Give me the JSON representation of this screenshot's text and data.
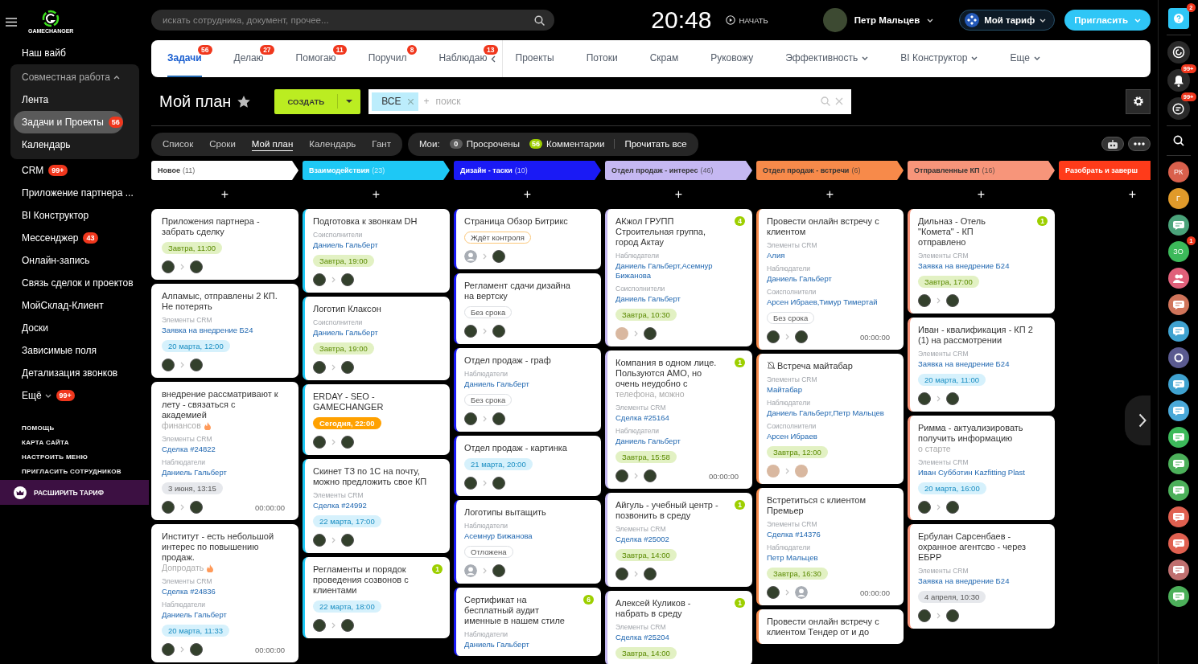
{
  "brand": {
    "name": "GAMECHANGER"
  },
  "sidebar": {
    "items": [
      {
        "label": "Наш вайб"
      },
      {
        "label": "Совместная работа",
        "kind": "group",
        "expanded": true,
        "children": [
          {
            "label": "Лента",
            "selected": false
          },
          {
            "label": "Задачи и Проекты",
            "selected": true,
            "badge": "56"
          },
          {
            "label": "Календарь",
            "selected": false
          }
        ]
      },
      {
        "label": "CRM",
        "badge": "99+"
      },
      {
        "label": "Приложение партнера ..."
      },
      {
        "label": "BI Конструктор"
      },
      {
        "label": "Мессенджер",
        "badge": "43"
      },
      {
        "label": "Онлайн-запись"
      },
      {
        "label": "Связь сделок и проектов"
      },
      {
        "label": "МойСклад-Клиент"
      },
      {
        "label": "Доски"
      },
      {
        "label": "Зависимые поля"
      },
      {
        "label": "Детализация звонков"
      },
      {
        "label": "Ещё",
        "badge": "99+",
        "kind": "more"
      }
    ],
    "links": [
      "ПОМОЩЬ",
      "КАРТА САЙТА",
      "НАСТРОИТЬ МЕНЮ",
      "ПРИГЛАСИТЬ СОТРУДНИКОВ"
    ],
    "upgrade": "РАСШИРИТЬ ТАРИФ"
  },
  "header": {
    "search": {
      "placeholder": "искать сотрудника, документ, прочее..."
    },
    "clock": "20:48",
    "start": "НАЧАТЬ",
    "user": "Петр Мальцев",
    "plan": "Мой тариф",
    "invite": "Пригласить"
  },
  "tabs": [
    {
      "label": "Задачи",
      "count": "56",
      "selected": true,
      "kind": "counter"
    },
    {
      "label": "Делаю",
      "count": "27",
      "selected": false,
      "kind": "counter"
    },
    {
      "label": "Помогаю",
      "count": "11",
      "selected": false,
      "kind": "counter"
    },
    {
      "label": "Поручил",
      "count": "8",
      "selected": false,
      "kind": "counter"
    },
    {
      "label": "Наблюдаю",
      "count": "13",
      "selected": false,
      "kind": "counter"
    },
    {
      "label": "Проекты",
      "selected": false,
      "kind": "plain"
    },
    {
      "label": "Потоки",
      "selected": false,
      "kind": "plain"
    },
    {
      "label": "Скрам",
      "selected": false,
      "kind": "plain"
    },
    {
      "label": "Руковожу",
      "selected": false,
      "kind": "plain"
    },
    {
      "label": "Эффективность",
      "selected": false,
      "kind": "dropdown"
    },
    {
      "label": "BI Конструктор",
      "selected": false,
      "kind": "dropdown"
    },
    {
      "label": "Еще",
      "selected": false,
      "kind": "dropdown"
    }
  ],
  "toolbar": {
    "title": "Мой план",
    "create": "СОЗДАТЬ",
    "filter_chip": "ВСЕ",
    "plus": "+",
    "search": {
      "placeholder": "поиск"
    }
  },
  "views": [
    {
      "label": "Список",
      "selected": false
    },
    {
      "label": "Сроки",
      "selected": false
    },
    {
      "label": "Мой план",
      "selected": true
    },
    {
      "label": "Календарь",
      "selected": false
    },
    {
      "label": "Гант",
      "selected": false
    }
  ],
  "counters": {
    "label": "Мои:",
    "items": [
      {
        "count": "0",
        "label": "Просрочены",
        "color": "#5c5c5c"
      },
      {
        "count": "56",
        "label": "Комментарии",
        "color": "#9dcf00"
      }
    ],
    "read_all": "Прочитать все"
  },
  "columns": [
    {
      "title": "Новое",
      "count": "(11)",
      "color": "#ffffff",
      "add": "+",
      "cards": [
        {
          "title": "Приложения партнера - забрать сделку",
          "deadline": {
            "text": "Завтра, 11:00",
            "kind": "soon"
          },
          "avatars": [
            {
              "kind": "photo"
            },
            {
              "kind": "photo"
            }
          ]
        },
        {
          "title": "Алпамыс, отправлены 2 КП. Не потерять",
          "fields": [
            {
              "label": "Элементы CRM",
              "value": "Заявка на внедрение Б24"
            }
          ],
          "deadline": {
            "text": "20 марта, 12:00",
            "kind": "date"
          },
          "avatars": [
            {
              "kind": "photo"
            },
            {
              "kind": "photo"
            }
          ]
        },
        {
          "title": "внедрение рассматривают к лету - связаться с академией",
          "more": "финансов",
          "hot": true,
          "fields": [
            {
              "label": "Элементы CRM",
              "value": "Сделка #24822"
            },
            {
              "label": "Наблюдатели",
              "value": "Даниель Гальберт"
            }
          ],
          "deadline": {
            "text": "3 июня, 13:15",
            "kind": "later"
          },
          "avatars": [
            {
              "kind": "photo"
            },
            {
              "kind": "photo"
            }
          ],
          "timer": "00:00:00"
        },
        {
          "title": "Институт - есть небольшой интерес по повышению продаж.",
          "more": "Допродать",
          "hot": true,
          "fields": [
            {
              "label": "Элементы CRM",
              "value": "Сделка #24836"
            },
            {
              "label": "Наблюдатели",
              "value": "Даниель Гальберт"
            }
          ],
          "deadline": {
            "text": "20 марта, 11:33",
            "kind": "date"
          },
          "avatars": [
            {
              "kind": "photo"
            },
            {
              "kind": "photo"
            }
          ],
          "timer": "00:00:00"
        }
      ]
    },
    {
      "title": "Взаимодействия",
      "count": "(23)",
      "color": "#1ec8f5",
      "add": "+",
      "cards": [
        {
          "title": "Подготовка к звонкам DH",
          "fields": [
            {
              "label": "Соисполнители",
              "value": "Даниель Гальберт"
            }
          ],
          "deadline": {
            "text": "Завтра, 19:00",
            "kind": "soon"
          },
          "avatars": [
            {
              "kind": "photo"
            },
            {
              "kind": "photo"
            }
          ]
        },
        {
          "title": "Логотип Клаксон",
          "fields": [
            {
              "label": "Соисполнители",
              "value": "Даниель Гальберт"
            }
          ],
          "deadline": {
            "text": "Завтра, 19:00",
            "kind": "soon"
          },
          "avatars": [
            {
              "kind": "photo"
            },
            {
              "kind": "photo"
            }
          ]
        },
        {
          "title": "ERDAY - SEO - GAMECHANGER",
          "deadline": {
            "text": "Сегодня, 22:00",
            "kind": "today"
          },
          "avatars": [
            {
              "kind": "photo"
            },
            {
              "kind": "photo"
            }
          ]
        },
        {
          "title": "Скинет ТЗ по 1С на почту, можно предложить свое КП",
          "fields": [
            {
              "label": "Элементы CRM",
              "value": "Сделка #24992"
            }
          ],
          "deadline": {
            "text": "22 марта, 17:00",
            "kind": "date"
          },
          "avatars": [
            {
              "kind": "photo"
            },
            {
              "kind": "photo"
            }
          ]
        },
        {
          "title": "Регламенты и порядок проведения созвонов с клиентами",
          "counter": "1",
          "deadline": {
            "text": "22 марта, 18:00",
            "kind": "date"
          },
          "avatars": [
            {
              "kind": "photo"
            },
            {
              "kind": "photo"
            }
          ]
        }
      ]
    },
    {
      "title": "Дизайн - таски",
      "count": "(10)",
      "color": "#1a1af5",
      "add": "+",
      "cards": [
        {
          "title": "Страница Обзор Битрикс",
          "deadline": {
            "text": "Ждёт контроля",
            "kind": "waiting"
          },
          "avatars": [
            {
              "kind": "blank"
            },
            {
              "kind": "photo"
            }
          ]
        },
        {
          "title": "Регламент сдачи дизайна на вертску",
          "deadline": {
            "text": "Без срока",
            "kind": "none"
          },
          "avatars": [
            {
              "kind": "photo"
            },
            {
              "kind": "photo"
            }
          ]
        },
        {
          "title": "Отдел продаж - граф",
          "fields": [
            {
              "label": "Наблюдатели",
              "value": "Даниель Гальберт"
            }
          ],
          "deadline": {
            "text": "Без срока",
            "kind": "none"
          },
          "avatars": [
            {
              "kind": "photo"
            },
            {
              "kind": "photo"
            }
          ]
        },
        {
          "title": "Отдел продаж - картинка",
          "deadline": {
            "text": "21 марта, 20:00",
            "kind": "date"
          },
          "avatars": [
            {
              "kind": "photo"
            },
            {
              "kind": "photo"
            }
          ]
        },
        {
          "title": "Логотипы вытащить",
          "fields": [
            {
              "label": "Наблюдатели",
              "value": "Асемнур Бижанова"
            }
          ],
          "deadline": {
            "text": "Отложена",
            "kind": "none"
          },
          "avatars": [
            {
              "kind": "blank"
            },
            {
              "kind": "photo"
            }
          ]
        },
        {
          "title": "Сертификат на бесплатный аудит именные в нашем стиле",
          "counter": "6",
          "fields": [
            {
              "label": "Наблюдатели",
              "value": "Даниель Гальберт"
            }
          ]
        }
      ]
    },
    {
      "title": "Отдел продаж - интерес",
      "count": "(46)",
      "color": "#c5b8f2",
      "add": "+",
      "cards": [
        {
          "title": "АКжол ГРУПП Строительная группа, город Актау",
          "counter": "4",
          "fields": [
            {
              "label": "Наблюдатели",
              "value": "Даниель Гальберт,Асемнур Бижанова"
            },
            {
              "label": "Соисполнители",
              "value": "Даниель Гальберт"
            }
          ],
          "deadline": {
            "text": "Завтра, 10:30",
            "kind": "soon"
          },
          "avatars": [
            {
              "kind": "light"
            },
            {
              "kind": "photo"
            }
          ]
        },
        {
          "title": "Компания в одном лице. Пользуются АМО, но очень неудобно с",
          "more": "телефона, можно",
          "counter": "1",
          "fields": [
            {
              "label": "Элементы CRM",
              "value": "Сделка #25164"
            },
            {
              "label": "Наблюдатели",
              "value": "Даниель Гальберт"
            }
          ],
          "deadline": {
            "text": "Завтра, 15:58",
            "kind": "soon"
          },
          "avatars": [
            {
              "kind": "photo"
            },
            {
              "kind": "photo"
            }
          ],
          "timer": "00:00:00"
        },
        {
          "title": "Айгуль - учебный центр - позвонить в среду",
          "counter": "1",
          "fields": [
            {
              "label": "Элементы CRM",
              "value": "Сделка #25002"
            }
          ],
          "deadline": {
            "text": "Завтра, 14:00",
            "kind": "soon"
          },
          "avatars": [
            {
              "kind": "photo"
            },
            {
              "kind": "photo"
            }
          ]
        },
        {
          "title": "Алексей Куликов - набрать в среду",
          "counter": "1",
          "fields": [
            {
              "label": "Элементы CRM",
              "value": "Сделка #25204"
            }
          ],
          "deadline": {
            "text": "Завтра, 14:00",
            "kind": "soon"
          }
        }
      ]
    },
    {
      "title": "Отдел продаж - встречи",
      "count": "(6)",
      "color": "#f78a4a",
      "add": "+",
      "cards": [
        {
          "title": "Провести онлайн встречу с клиентом",
          "fields": [
            {
              "label": "Элементы CRM",
              "value": "Алия"
            },
            {
              "label": "Наблюдатели",
              "value": "Даниель Гальберт"
            },
            {
              "label": "Соисполнители",
              "value": "Арсен Ибраев,Тимур Тимертай"
            }
          ],
          "deadline": {
            "text": "Без срока",
            "kind": "none"
          },
          "avatars": [
            {
              "kind": "photo"
            },
            {
              "kind": "photo"
            }
          ],
          "timer": "00:00:00"
        },
        {
          "title": "Встреча майтабар",
          "muted": true,
          "fields": [
            {
              "label": "Элементы CRM",
              "value": "Майтабар"
            },
            {
              "label": "Наблюдатели",
              "value": "Даниель Гальберт,Петр Мальцев"
            },
            {
              "label": "Соисполнители",
              "value": "Арсен Ибраев"
            }
          ],
          "deadline": {
            "text": "Завтра, 12:00",
            "kind": "soon"
          },
          "avatars": [
            {
              "kind": "light"
            },
            {
              "kind": "light"
            }
          ]
        },
        {
          "title": "Встретиться с клиентом Премьер",
          "fields": [
            {
              "label": "Элементы CRM",
              "value": "Сделка #14376"
            },
            {
              "label": "Наблюдатели",
              "value": "Петр Мальцев"
            }
          ],
          "deadline": {
            "text": "Завтра, 16:30",
            "kind": "soon"
          },
          "avatars": [
            {
              "kind": "photo"
            },
            {
              "kind": "blank"
            }
          ],
          "timer": "00:00:00"
        },
        {
          "title": "Провести онлайн встречу с клиентом Тендер от и до"
        }
      ]
    },
    {
      "title": "Отправленные КП",
      "count": "(16)",
      "color": "#f7957a",
      "add": "+",
      "cards": [
        {
          "title": "Дильназ - Отель \"Комета\" - КП отправлено",
          "counter": "1",
          "fields": [
            {
              "label": "Элементы CRM",
              "value": "Заявка на внедрение Б24"
            }
          ],
          "deadline": {
            "text": "Завтра, 17:00",
            "kind": "soon"
          },
          "avatars": [
            {
              "kind": "photo"
            },
            {
              "kind": "photo"
            }
          ]
        },
        {
          "title": "Иван - квалификация - КП 2 (1) на рассмотрении",
          "fields": [
            {
              "label": "Элементы CRM",
              "value": "Заявка на внедрение Б24"
            }
          ],
          "deadline": {
            "text": "20 марта, 11:00",
            "kind": "date"
          },
          "avatars": [
            {
              "kind": "photo"
            },
            {
              "kind": "photo"
            }
          ]
        },
        {
          "title": "Римма - актуализировать получить информацию",
          "more": "о старте",
          "fields": [
            {
              "label": "Элементы CRM",
              "value": "Иван Субботин Kazfitting Plast"
            }
          ],
          "deadline": {
            "text": "20 марта, 16:00",
            "kind": "date"
          },
          "avatars": [
            {
              "kind": "photo"
            },
            {
              "kind": "photo"
            }
          ]
        },
        {
          "title": "Ербулан Сарсенбаев - охранное агентсво - через ЕБРР",
          "fields": [
            {
              "label": "Элементы CRM",
              "value": "Заявка на внедрение Б24"
            }
          ],
          "deadline": {
            "text": "4 апреля, 10:30",
            "kind": "later"
          },
          "avatars": [
            {
              "kind": "photo"
            },
            {
              "kind": "photo"
            }
          ]
        }
      ]
    },
    {
      "title": "Разобрать и заверш",
      "color": "#ff3b1a",
      "add": "+"
    }
  ],
  "rail": {
    "help_badge": "2",
    "bell_badge": "99+",
    "chat_badge": "99+",
    "contacts": [
      {
        "kind": "initials",
        "text": "РК",
        "color": "#d9604c"
      },
      {
        "kind": "initials",
        "text": "Г",
        "color": "#e09a2a"
      },
      {
        "kind": "chat",
        "color": "#4aa37a"
      },
      {
        "kind": "initials",
        "text": "ЗО",
        "color": "#3cb95a",
        "badge": "1"
      },
      {
        "kind": "person",
        "color": "#e0607a"
      },
      {
        "kind": "chat",
        "color": "#d0745a"
      },
      {
        "kind": "chat",
        "color": "#3fa2d0"
      },
      {
        "kind": "ring",
        "color": "#5a5a90"
      },
      {
        "kind": "chat",
        "color": "#3fa2d0"
      },
      {
        "kind": "chat",
        "color": "#4aa8d8"
      },
      {
        "kind": "chat",
        "color": "#3cba5a"
      },
      {
        "kind": "chat",
        "color": "#4cb05a"
      },
      {
        "kind": "chat",
        "color": "#4cb05a"
      },
      {
        "kind": "chat",
        "color": "#e06050"
      },
      {
        "kind": "chat",
        "color": "#e06050"
      },
      {
        "kind": "chat",
        "color": "#c07070"
      },
      {
        "kind": "chat",
        "color": "#4cb05a"
      }
    ]
  }
}
